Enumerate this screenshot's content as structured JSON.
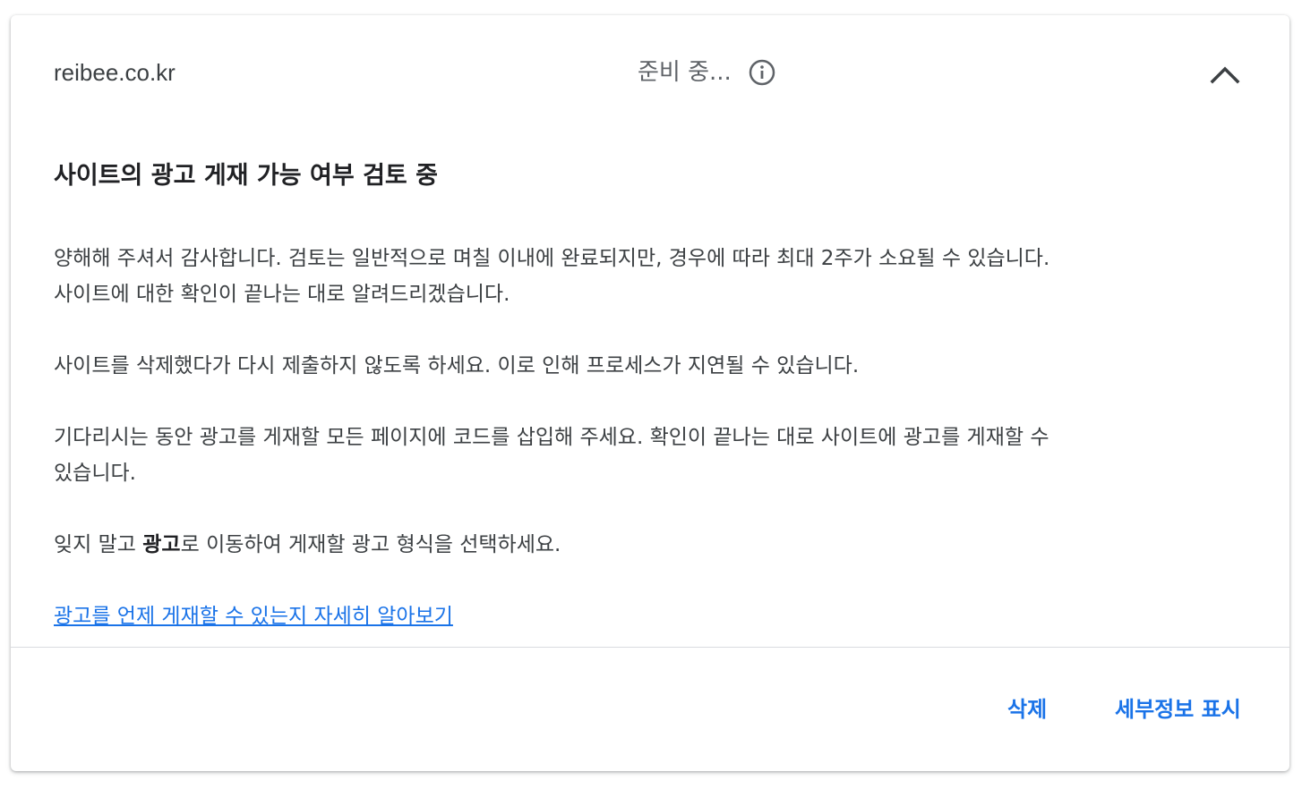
{
  "header": {
    "site_name": "reibee.co.kr",
    "status": "준비 중...",
    "info_icon": "info-icon",
    "collapse_icon": "chevron-up-icon"
  },
  "content": {
    "heading": "사이트의 광고 게재 가능 여부 검토 중",
    "para1_line1": "양해해 주셔서 감사합니다. 검토는 일반적으로 며칠 이내에 완료되지만, 경우에 따라 최대 2주가 소요될 수 있습니다.",
    "para1_line2": "사이트에 대한 확인이 끝나는 대로 알려드리겠습니다.",
    "para2": "사이트를 삭제했다가 다시 제출하지 않도록 하세요. 이로 인해 프로세스가 지연될 수 있습니다.",
    "para3_line1": "기다리시는 동안 광고를 게재할 모든 페이지에 코드를 삽입해 주세요. 확인이 끝나는 대로 사이트에 광고를 게재할 수",
    "para3_line2": "있습니다.",
    "para4_before": "잊지 말고 ",
    "para4_bold": "광고",
    "para4_after": "로 이동하여 게재할 광고 형식을 선택하세요.",
    "learn_more_link": "광고를 언제 게재할 수 있는지 자세히 알아보기"
  },
  "footer": {
    "delete_label": "삭제",
    "details_label": "세부정보 표시"
  },
  "colors": {
    "accent": "#1a73e8",
    "text_primary": "#202124",
    "text_secondary": "#3c4043",
    "status_text": "#5f6368",
    "divider": "#dadce0"
  }
}
